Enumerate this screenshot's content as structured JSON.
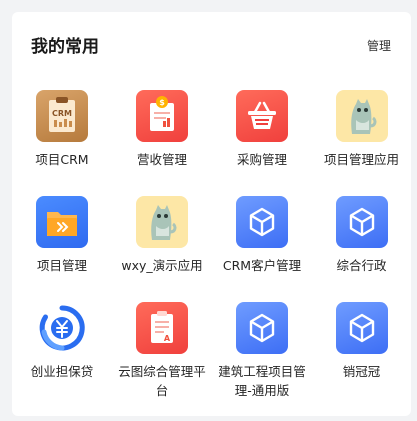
{
  "header": {
    "title": "我的常用",
    "manage_label": "管理"
  },
  "apps": [
    {
      "label": "项目CRM",
      "icon": "crm-clipboard-icon",
      "color": "#c98c4c"
    },
    {
      "label": "营收管理",
      "icon": "revenue-document-icon",
      "color": "#f0503d"
    },
    {
      "label": "采购管理",
      "icon": "shopping-basket-icon",
      "color": "#f0403d"
    },
    {
      "label": "项目管理应用",
      "icon": "cat-mascot-icon",
      "color": "#fde7a6"
    },
    {
      "label": "项目管理",
      "icon": "folder-icon",
      "color": "#3d6ef5"
    },
    {
      "label": "wxy_演示应用",
      "icon": "cat-mascot-icon",
      "color": "#fde7a6"
    },
    {
      "label": "CRM客户管理",
      "icon": "cube-icon",
      "color": "#4f7ff6"
    },
    {
      "label": "综合行政",
      "icon": "cube-icon",
      "color": "#4f7ff6"
    },
    {
      "label": "创业担保贷",
      "icon": "circular-currency-logo-icon",
      "color": "#2a6df0"
    },
    {
      "label": "云图综合管理平台",
      "icon": "document-list-icon",
      "color": "#f0503d"
    },
    {
      "label": "建筑工程项目管理-通用版",
      "icon": "cube-icon",
      "color": "#4f7ff6"
    },
    {
      "label": "销冠冠",
      "icon": "cube-icon",
      "color": "#4f7ff6"
    }
  ]
}
